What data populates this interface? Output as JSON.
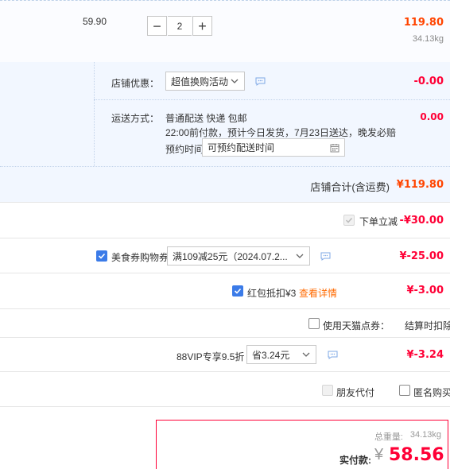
{
  "item": {
    "unit_price": "59.90",
    "quantity": "2",
    "minus_label": "−",
    "plus_label": "+",
    "subtotal": "119.80",
    "weight": "34.13kg"
  },
  "shop": {
    "discount_label": "店铺优惠：",
    "discount_select": "超值换购活动",
    "discount_value": "-0.00",
    "shipping_label": "运送方式：",
    "shipping_method": "普通配送 快递 包邮",
    "shipping_note": "22:00前付款，预计今日发货，7月23日送达，晚发必赔",
    "shipping_value": "0.00",
    "schedule_label": "预约时间",
    "schedule_value": "可预约配送时间",
    "shop_total_label": "店铺合计(含运费)",
    "shop_total_value": "¥119.80"
  },
  "discounts": {
    "instant_label": "下单立减",
    "instant_value": "-¥30.00",
    "coupon_label": "美食券购物券",
    "coupon_select": "满109减25元（2024.07.2...",
    "coupon_value": "¥-25.00",
    "redpacket_label": "红包抵扣¥3",
    "redpacket_link": "查看详情",
    "redpacket_value": "¥-3.00",
    "tmall_points_label": "使用天猫点券：",
    "tmall_points_note": "结算时扣除",
    "vip_label": "88VIP专享9.5折",
    "vip_select": "省3.24元",
    "vip_value": "¥-3.24",
    "friend_pay_label": "朋友代付",
    "anonymous_label": "匿名购买"
  },
  "summary": {
    "weight_label": "总重量:",
    "weight_value": "34.13kg",
    "pay_label": "实付款:",
    "currency": "¥",
    "pay_value": "58.56"
  },
  "colors": {
    "accent_red": "#ff0036",
    "accent_orange": "#ff4400",
    "checkbox_blue": "#3b7be8",
    "link_orange": "#ff6a00",
    "section_blue": "#f2f7ff"
  }
}
